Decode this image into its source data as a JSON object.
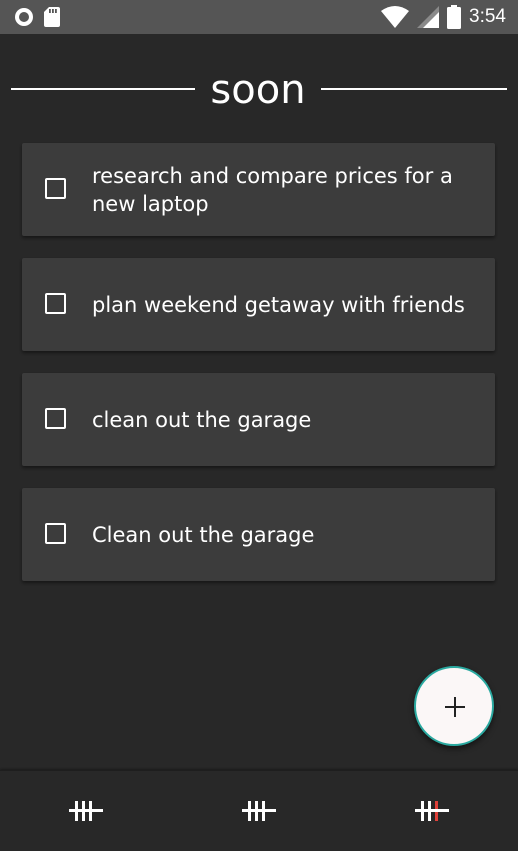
{
  "status_bar": {
    "time": "3:54",
    "icons": [
      "circle-notification-icon",
      "sd-card-icon",
      "wifi-icon",
      "cell-signal-icon",
      "battery-icon"
    ]
  },
  "header": {
    "title": "soon"
  },
  "tasks": [
    {
      "text": "research and compare prices for a new laptop",
      "checked": false
    },
    {
      "text": "plan weekend getaway with friends",
      "checked": false
    },
    {
      "text": "clean out the garage",
      "checked": false
    },
    {
      "text": "Clean out the garage",
      "checked": false
    }
  ],
  "fab": {
    "icon": "plus-icon"
  },
  "bottom_nav": {
    "items": [
      {
        "icon": "tally-icon",
        "active": false
      },
      {
        "icon": "tally-icon",
        "active": false
      },
      {
        "icon": "tally-icon",
        "active": true
      }
    ]
  },
  "colors": {
    "background": "#282828",
    "card": "#3c3c3c",
    "status_bar": "#555555",
    "fab_background": "#fbf7f7",
    "fab_border": "#2aa9a0",
    "active_accent": "#e0413a"
  }
}
